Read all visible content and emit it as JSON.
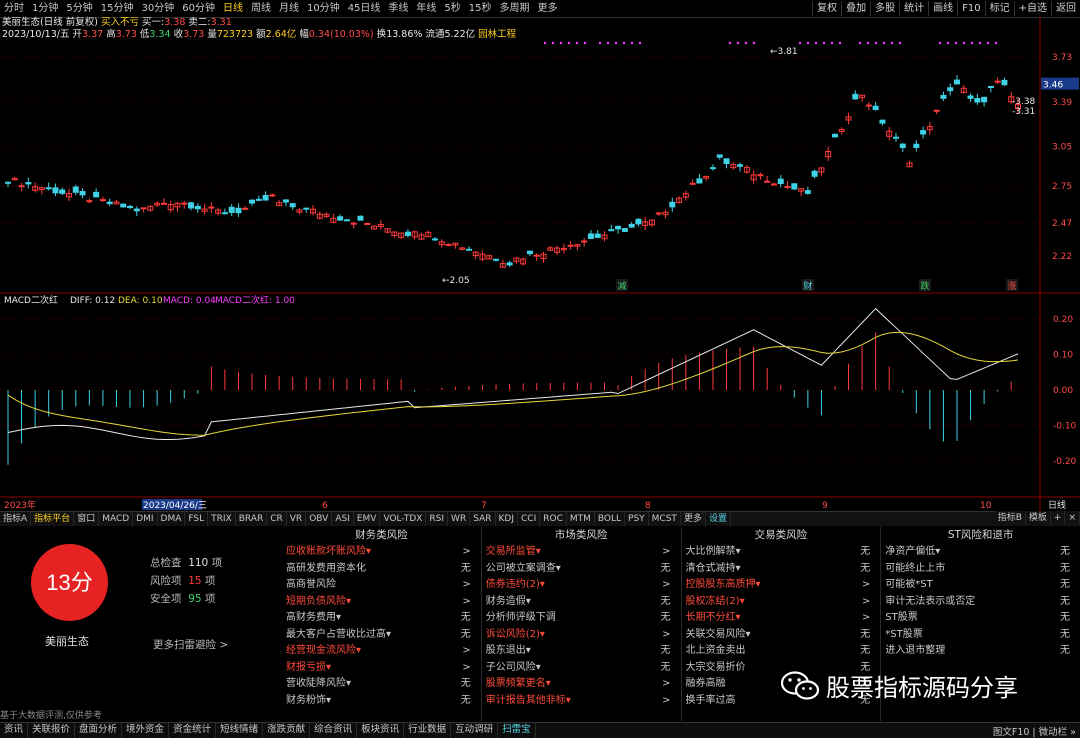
{
  "toolbar": {
    "timeframes": [
      "分时",
      "1分钟",
      "5分钟",
      "15分钟",
      "30分钟",
      "60分钟",
      "日线",
      "周线",
      "月线",
      "10分钟",
      "45日线",
      "季线",
      "年线",
      "5秒",
      "15秒",
      "多周期",
      "更多"
    ],
    "active_index": 6,
    "right_buttons": [
      "复权",
      "叠加",
      "多股",
      "统计",
      "画线",
      "F10",
      "标记",
      "+自选",
      "返回"
    ]
  },
  "header": {
    "stock_title": "美丽生态(日线 前复权)",
    "buy_sell": "买入不亏",
    "bid1_label": "买一:",
    "bid1": "3.38",
    "bid2_label": "卖二:",
    "bid2": "3.31",
    "date": "2023/10/13/五",
    "open_label": "开",
    "open": "3.37",
    "high_label": "高",
    "high": "3.73",
    "low_label": "低",
    "low": "3.34",
    "close_label": "收",
    "close": "3.73",
    "vol_label": "量",
    "vol": "723723",
    "amt_label": "额",
    "amt": "2.64亿",
    "chg_label": "幅",
    "chg": "0.34(10.03%)",
    "turn_label": "换",
    "turn": "13.86%",
    "float_label": "流通",
    "float": "5.22亿",
    "sector": "园林工程"
  },
  "price_axis": {
    "ticks": [
      "3.73",
      "3.39",
      "3.05",
      "2.75",
      "2.47",
      "2.22"
    ],
    "current": "3.46",
    "marker_high": "3.38",
    "marker_low": "3.31",
    "peak_label": "3.81",
    "low_label": "2.05"
  },
  "chart_events": [
    "减",
    "财",
    "跌",
    "涨"
  ],
  "macd_header": {
    "name": "MACD二次红",
    "diff_label": "DIFF:",
    "diff": "0.12",
    "dea_label": "DEA:",
    "dea": "0.10",
    "macd_label": "MACD:",
    "macd": "0.04",
    "red2_label": "MACD二次红:",
    "red2": "1.00"
  },
  "macd_axis": [
    "0.20",
    "0.10",
    "0.00",
    "-0.10",
    "-0.20"
  ],
  "date_axis": {
    "labels": [
      "2023年",
      "2023/04/26/三",
      "6",
      "7",
      "8",
      "9",
      "10"
    ],
    "period": "日线"
  },
  "indicator_tabs": [
    "指标A",
    "指标平台",
    "窗口",
    "MACD",
    "DMI",
    "DMA",
    "FSL",
    "TRIX",
    "BRAR",
    "CR",
    "VR",
    "OBV",
    "ASI",
    "EMV",
    "VOL-TDX",
    "RSI",
    "WR",
    "SAR",
    "KDJ",
    "CCI",
    "ROC",
    "MTM",
    "BOLL",
    "PSY",
    "MCST",
    "更多",
    "设置"
  ],
  "indicator_right": [
    "指标B",
    "模板",
    "+",
    "×"
  ],
  "risk": {
    "score": "13分",
    "stock_name": "美丽生态",
    "total_label": "总检查",
    "total": "110",
    "total_unit": "项",
    "risk_label": "风险项",
    "risk_count": "15",
    "risk_unit": "项",
    "safe_label": "安全项",
    "safe_count": "95",
    "safe_unit": "项",
    "more_link": "更多扫雷避险 >",
    "disclaimer": "基于大数据评测,仅供参考",
    "columns": [
      {
        "title": "财务类风险",
        "items": [
          {
            "name": "应收账款坏账风险▾",
            "value": ">",
            "risk": true
          },
          {
            "name": "高研发费用资本化",
            "value": "无",
            "risk": false
          },
          {
            "name": "高商誉风险",
            "value": ">",
            "risk": false
          },
          {
            "name": "短期负债风险▾",
            "value": ">",
            "risk": true
          },
          {
            "name": "高财务费用▾",
            "value": "无",
            "risk": false
          },
          {
            "name": "最大客户占营收比过高▾",
            "value": "无",
            "risk": false
          },
          {
            "name": "经营现金流风险▾",
            "value": ">",
            "risk": true
          },
          {
            "name": "财报亏损▾",
            "value": ">",
            "risk": true
          },
          {
            "name": "营收陡降风险▾",
            "value": "无",
            "risk": false
          },
          {
            "name": "财务粉饰▾",
            "value": "无",
            "risk": false
          }
        ]
      },
      {
        "title": "市场类风险",
        "items": [
          {
            "name": "交易所监管▾",
            "value": ">",
            "risk": true
          },
          {
            "name": "公司被立案调查▾",
            "value": "无",
            "risk": false
          },
          {
            "name": "债券违约(2)▾",
            "value": ">",
            "risk": true
          },
          {
            "name": "财务造假▾",
            "value": "无",
            "risk": false
          },
          {
            "name": "分析师评级下调",
            "value": "无",
            "risk": false
          },
          {
            "name": "诉讼风险(2)▾",
            "value": ">",
            "risk": true
          },
          {
            "name": "股东退出▾",
            "value": "无",
            "risk": false
          },
          {
            "name": "子公司风险▾",
            "value": "无",
            "risk": false
          },
          {
            "name": "股票频繁更名▾",
            "value": ">",
            "risk": true
          },
          {
            "name": "审计报告其他非标▾",
            "value": ">",
            "risk": true
          }
        ]
      },
      {
        "title": "交易类风险",
        "items": [
          {
            "name": "大比例解禁▾",
            "value": "无",
            "risk": false
          },
          {
            "name": "清仓式减持▾",
            "value": "无",
            "risk": false
          },
          {
            "name": "控股股东高质押▾",
            "value": ">",
            "risk": true
          },
          {
            "name": "股权冻结(2)▾",
            "value": ">",
            "risk": true
          },
          {
            "name": "长期不分红▾",
            "value": ">",
            "risk": true
          },
          {
            "name": "关联交易风险▾",
            "value": "无",
            "risk": false
          },
          {
            "name": "北上资金卖出",
            "value": "无",
            "risk": false
          },
          {
            "name": "大宗交易折价",
            "value": "无",
            "risk": false
          },
          {
            "name": "融券高融",
            "value": "无",
            "risk": false
          },
          {
            "name": "换手率过高",
            "value": "无",
            "risk": false
          }
        ]
      },
      {
        "title": "ST风险和退市",
        "items": [
          {
            "name": "净资产偏低▾",
            "value": "无",
            "risk": false
          },
          {
            "name": "可能终止上市",
            "value": "无",
            "risk": false
          },
          {
            "name": "可能被*ST",
            "value": "无",
            "risk": false
          },
          {
            "name": "审计无法表示或否定",
            "value": "无",
            "risk": false
          },
          {
            "name": "ST股票",
            "value": "无",
            "risk": false
          },
          {
            "name": "*ST股票",
            "value": "无",
            "risk": false
          },
          {
            "name": "进入退市整理",
            "value": "无",
            "risk": false
          }
        ]
      }
    ]
  },
  "watermark": "股票指标源码分享",
  "status_bar": {
    "items": [
      "资讯",
      "关联报价",
      "盘面分析",
      "境外资金",
      "资金统计",
      "短线情绪",
      "涨跌贡献",
      "综合资讯",
      "板块资讯",
      "行业数据",
      "互动调研",
      "扫雷宝"
    ],
    "right": "图文F10 |  微动栏 »"
  },
  "colors": {
    "up": "#ff3b3b",
    "down": "#3fd2e6",
    "bg": "#000000",
    "diff": "#e8e8e8",
    "dea": "#e6d83c",
    "active": "#ffd21f",
    "score": "#e62222"
  }
}
